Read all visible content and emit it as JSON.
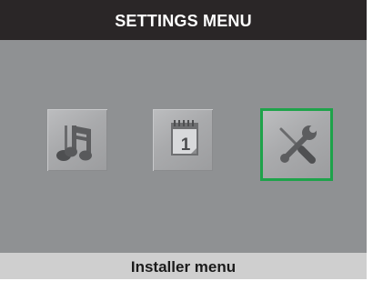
{
  "header": {
    "title": "SETTINGS MENU"
  },
  "menu": {
    "items": [
      {
        "id": "sounds",
        "icon": "music-notes-icon"
      },
      {
        "id": "date",
        "icon": "calendar-icon",
        "calendar_day": "1"
      },
      {
        "id": "installer",
        "icon": "tools-icon",
        "selected": true
      }
    ]
  },
  "footer": {
    "label": "Installer menu"
  },
  "colors": {
    "background": "#8f9193",
    "header_bg": "#2a2627",
    "footer_bg": "#cfcfcf",
    "selection": "#1ea34a"
  }
}
